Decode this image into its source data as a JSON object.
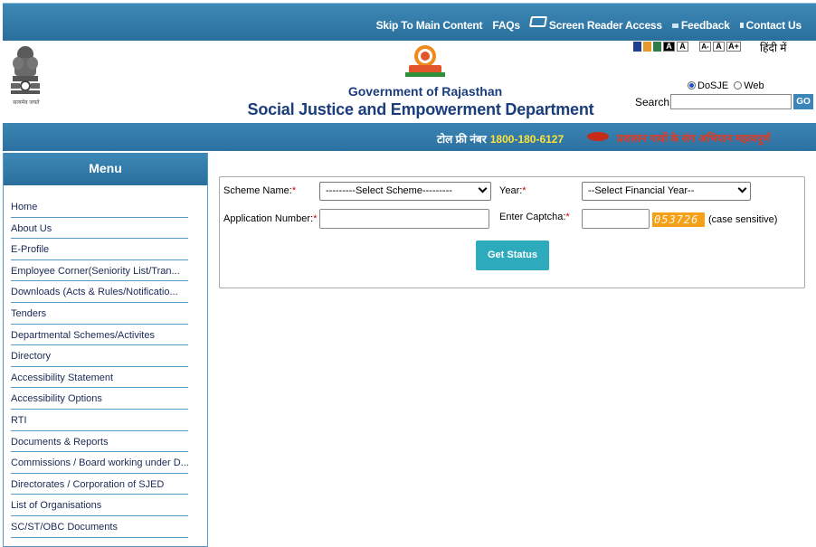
{
  "topbar": {
    "skip": "Skip To Main Content",
    "faqs": "FAQs",
    "screen_reader": "Screen Reader Access",
    "feedback": "Feedback",
    "contact": "Contact Us"
  },
  "header": {
    "gov_title": "Government of Rajasthan",
    "dept_title": "Social Justice and Empowerment Department",
    "hindi": "हिंदी में",
    "text_small": "A-",
    "text_normal": "A",
    "text_large": "A+",
    "contrast_dark": "A",
    "contrast_light": "A",
    "theme_colors": [
      "#1f3e8c",
      "#e59a2b",
      "#2f7e4a"
    ],
    "search": {
      "opt_site": "DoSJE",
      "opt_web": "Web",
      "label": "Search:",
      "value": "",
      "go": "GO"
    }
  },
  "tollbar": {
    "label": "टोल फ्री नंबर",
    "number": "1800-180-6127",
    "slogan": "प्रशासन गावों के संग अभियान महत्वपूर्ण"
  },
  "sidebar": {
    "heading": "Menu",
    "items": [
      "Home",
      "About Us",
      "E-Profile",
      "Employee Corner(Seniority List/Tran...",
      "Downloads (Acts & Rules/Notificatio...",
      "Tenders",
      "Departmental Schemes/Activites",
      "Directory",
      "Accessibility Statement",
      "Accessibility Options",
      "RTI",
      "Documents & Reports",
      "Commissions / Board working under D...",
      "Directorates / Corporation of SJED",
      "List of Organisations",
      "SC/ST/OBC Documents"
    ]
  },
  "form": {
    "scheme_label": "Scheme Name:",
    "scheme_value": "---------Select Scheme---------",
    "year_label": "Year:",
    "year_value": "--Select Financial Year--",
    "app_label": "Application Number:",
    "app_value": "",
    "captcha_label": "Enter Captcha:",
    "captcha_value": "",
    "captcha_code": "053726",
    "case_note": "(case sensitive)",
    "required_mark": "*",
    "submit": "Get Status"
  }
}
